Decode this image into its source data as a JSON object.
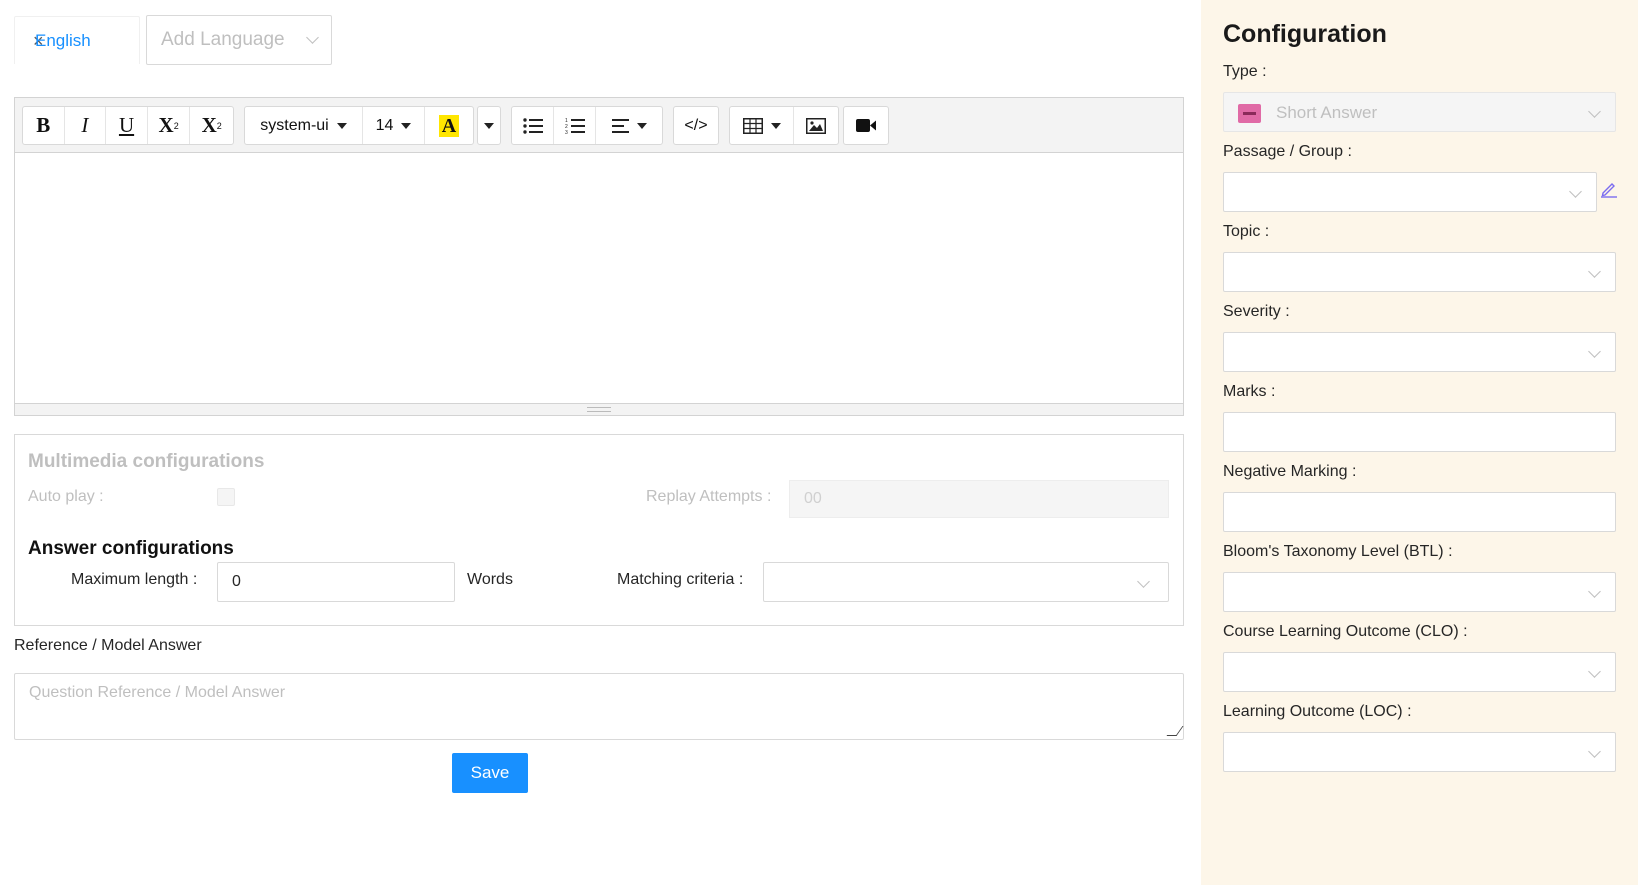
{
  "language_tabs": {
    "active_label": "English",
    "close_glyph": "×",
    "add_placeholder": "Add Language"
  },
  "editor": {
    "bold": "B",
    "italic": "I",
    "underline": "U",
    "superscript": "X",
    "subscript": "X",
    "font_family": "system-ui",
    "font_size": "14",
    "highlight": "A",
    "highlight_color": "#ffe600",
    "code": "</>",
    "icons": [
      "bold-icon",
      "italic-icon",
      "underline-icon",
      "superscript-icon",
      "subscript-icon",
      "text-color-icon",
      "bullet-list-icon",
      "numbered-list-icon",
      "align-icon",
      "code-view-icon",
      "table-icon",
      "image-icon",
      "video-icon"
    ]
  },
  "multimedia": {
    "title": "Multimedia configurations",
    "auto_play_label": "Auto play :",
    "replay_label": "Replay Attempts :",
    "replay_value": "00"
  },
  "answer": {
    "title": "Answer configurations",
    "max_length_label": "Maximum length :",
    "max_length_value": "0",
    "words_label": "Words",
    "matching_label": "Matching criteria :"
  },
  "reference": {
    "label": "Reference / Model Answer",
    "placeholder": "Question Reference / Model Answer"
  },
  "save_label": "Save",
  "side": {
    "title": "Configuration",
    "type_label": "Type :",
    "type_value": "Short Answer",
    "passage_label": "Passage / Group :",
    "topic_label": "Topic :",
    "severity_label": "Severity :",
    "marks_label": "Marks :",
    "negative_label": "Negative Marking :",
    "btl_label": "Bloom's Taxonomy Level (BTL) :",
    "clo_label": "Course Learning Outcome (CLO) :",
    "loc_label": "Learning Outcome (LOC) :"
  },
  "colors": {
    "accent": "#1890ff",
    "side_bg": "#fdf6e9",
    "type_icon": "#e06aa6"
  }
}
